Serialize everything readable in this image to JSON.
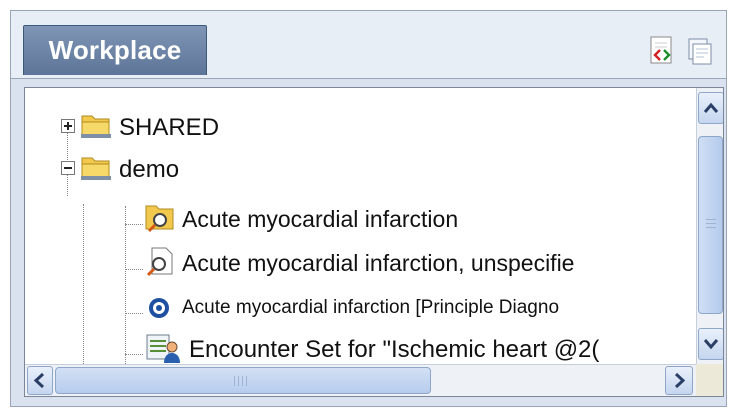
{
  "panel": {
    "tab_label": "Workplace",
    "header_buttons": [
      {
        "name": "code-view-icon"
      },
      {
        "name": "copy-window-icon"
      }
    ]
  },
  "tree": {
    "items": [
      {
        "label": "SHARED",
        "icon": "folder-icon",
        "state": "collapsed"
      },
      {
        "label": "demo",
        "icon": "folder-icon",
        "state": "expanded"
      },
      {
        "label": "Acute myocardial infarction",
        "icon": "search-folder-icon"
      },
      {
        "label": "Acute myocardial infarction, unspecifie",
        "icon": "search-document-icon"
      },
      {
        "label": "Acute myocardial infarction [Principle Diagno",
        "icon": "eye-target-icon"
      },
      {
        "label": "Encounter Set for \"Ischemic heart @2(",
        "icon": "patient-set-icon"
      }
    ]
  },
  "scrollbars": {
    "vertical": {
      "position": 0.2
    },
    "horizontal": {
      "position": 0.0
    }
  },
  "colors": {
    "tab_bg": "#6b83a6",
    "panel_bg": "#d9e2ee",
    "folder": "#f2c94c"
  }
}
